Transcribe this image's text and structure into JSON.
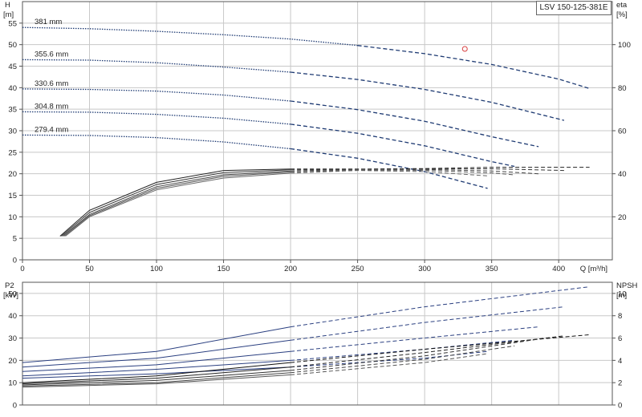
{
  "model": "LSV 150-125-381E",
  "chart_data": [
    {
      "type": "line",
      "panel": "head-efficiency",
      "y_left_label": "H",
      "y_left_unit": "[m]",
      "y_right_label": "eta",
      "y_right_unit": "[%]",
      "x_label": "Q [m³/h]",
      "xlim": [
        0,
        440
      ],
      "x_ticks": [
        0,
        50,
        100,
        150,
        200,
        250,
        300,
        350,
        400
      ],
      "y_left_lim": [
        0,
        60
      ],
      "y_left_ticks": [
        0,
        5,
        10,
        15,
        20,
        25,
        30,
        35,
        40,
        45,
        50,
        55
      ],
      "y_right_lim": [
        0,
        120
      ],
      "y_right_ticks": [
        20,
        40,
        60,
        80,
        100
      ],
      "grid": true,
      "series": [
        {
          "name": "381 mm",
          "kind": "head",
          "color": "#1f3b73",
          "x": [
            0,
            50,
            100,
            150,
            200,
            250,
            300,
            350,
            400,
            423
          ],
          "y": [
            54,
            53.7,
            53.1,
            52.3,
            51.3,
            49.8,
            47.9,
            45.4,
            42,
            39.8
          ]
        },
        {
          "name": "355.6 mm",
          "kind": "head",
          "color": "#1f3b73",
          "x": [
            0,
            50,
            100,
            150,
            200,
            250,
            300,
            350,
            404
          ],
          "y": [
            46.5,
            46.4,
            45.8,
            44.8,
            43.6,
            41.9,
            39.6,
            36.6,
            32.4
          ]
        },
        {
          "name": "330.6 mm",
          "kind": "head",
          "color": "#1f3b73",
          "x": [
            0,
            50,
            100,
            150,
            200,
            250,
            300,
            350,
            385
          ],
          "y": [
            39.7,
            39.6,
            39.2,
            38.3,
            36.9,
            34.9,
            32.2,
            28.6,
            26.3
          ]
        },
        {
          "name": "304.8 mm",
          "kind": "head",
          "color": "#1f3b73",
          "x": [
            0,
            50,
            100,
            150,
            200,
            250,
            300,
            350,
            367
          ],
          "y": [
            34.4,
            34.3,
            33.8,
            32.9,
            31.5,
            29.4,
            26.5,
            22.8,
            21.7
          ]
        },
        {
          "name": "279.4 mm",
          "kind": "head",
          "color": "#1f3b73",
          "x": [
            0,
            50,
            100,
            150,
            200,
            250,
            300,
            347
          ],
          "y": [
            29,
            28.9,
            28.4,
            27.4,
            25.8,
            23.6,
            20.5,
            16.6
          ]
        },
        {
          "kind": "eta",
          "color": "#222222",
          "x": [
            28,
            50,
            100,
            150,
            200,
            250,
            300,
            350,
            423
          ],
          "y": [
            11,
            23,
            36,
            41.5,
            42.2,
            42.2,
            42.4,
            43,
            43
          ]
        },
        {
          "kind": "eta",
          "color": "#333333",
          "x": [
            29,
            50,
            100,
            150,
            200,
            250,
            300,
            350,
            404
          ],
          "y": [
            11,
            22,
            35,
            40.5,
            41.8,
            42.1,
            42.2,
            42.3,
            41.5
          ]
        },
        {
          "kind": "eta",
          "color": "#444444",
          "x": [
            30,
            50,
            100,
            150,
            200,
            250,
            300,
            350,
            385
          ],
          "y": [
            11,
            21,
            34,
            39.5,
            41.3,
            42,
            42,
            41.3,
            40
          ]
        },
        {
          "kind": "eta",
          "color": "#555555",
          "x": [
            31,
            50,
            100,
            150,
            200,
            250,
            300,
            350,
            367
          ],
          "y": [
            11,
            20.5,
            33.2,
            38.8,
            40.8,
            41.7,
            41.6,
            40.4,
            39.5
          ]
        },
        {
          "kind": "eta",
          "color": "#666666",
          "x": [
            32,
            50,
            100,
            150,
            200,
            250,
            300,
            347
          ],
          "y": [
            11,
            20,
            32.5,
            38,
            40.3,
            41.5,
            41,
            39
          ]
        }
      ],
      "markers": [
        {
          "type": "circle",
          "color": "#d94040",
          "x": 330,
          "y": 49
        }
      ]
    },
    {
      "type": "line",
      "panel": "power-npsh",
      "y_left_label": "P2",
      "y_left_unit": "[kW]",
      "y_right_label": "NPSH",
      "y_right_unit": "[m]",
      "xlim": [
        0,
        440
      ],
      "y_left_lim": [
        0,
        55
      ],
      "y_left_ticks": [
        0,
        10,
        20,
        30,
        40,
        50
      ],
      "y_right_lim": [
        0,
        11
      ],
      "y_right_ticks": [
        0,
        2,
        4,
        6,
        8,
        10
      ],
      "grid": true,
      "series": [
        {
          "kind": "p2",
          "color": "#2a3f80",
          "x": [
            0,
            100,
            200,
            300,
            423
          ],
          "y": [
            19,
            24,
            35,
            44,
            53
          ]
        },
        {
          "kind": "p2",
          "color": "#2a3f80",
          "x": [
            0,
            100,
            200,
            300,
            404
          ],
          "y": [
            17,
            21,
            29,
            37,
            44
          ]
        },
        {
          "kind": "p2",
          "color": "#2a3f80",
          "x": [
            0,
            100,
            200,
            300,
            385
          ],
          "y": [
            15,
            18,
            24,
            30,
            35
          ]
        },
        {
          "kind": "p2",
          "color": "#2a3f80",
          "x": [
            0,
            100,
            200,
            300,
            367
          ],
          "y": [
            13,
            16,
            20,
            25,
            29
          ]
        },
        {
          "kind": "p2",
          "color": "#2a3f80",
          "x": [
            0,
            100,
            200,
            300,
            347
          ],
          "y": [
            12,
            14,
            17,
            21,
            24
          ]
        },
        {
          "kind": "npsh",
          "color": "#111111",
          "x": [
            0,
            100,
            200,
            300,
            423
          ],
          "y": [
            2,
            2.6,
            3.8,
            5,
            6.3
          ]
        },
        {
          "kind": "npsh",
          "color": "#222222",
          "x": [
            0,
            100,
            200,
            300,
            404
          ],
          "y": [
            1.9,
            2.4,
            3.4,
            4.7,
            6.2
          ]
        },
        {
          "kind": "npsh",
          "color": "#333333",
          "x": [
            0,
            100,
            200,
            300,
            385
          ],
          "y": [
            1.8,
            2.2,
            3.1,
            4.4,
            5.9
          ]
        },
        {
          "kind": "npsh",
          "color": "#444444",
          "x": [
            0,
            100,
            200,
            300,
            367
          ],
          "y": [
            1.7,
            2,
            2.9,
            4.1,
            5.3
          ]
        },
        {
          "kind": "npsh",
          "color": "#555555",
          "x": [
            0,
            100,
            200,
            300,
            347
          ],
          "y": [
            1.6,
            1.9,
            2.7,
            3.8,
            4.6
          ]
        }
      ]
    }
  ]
}
